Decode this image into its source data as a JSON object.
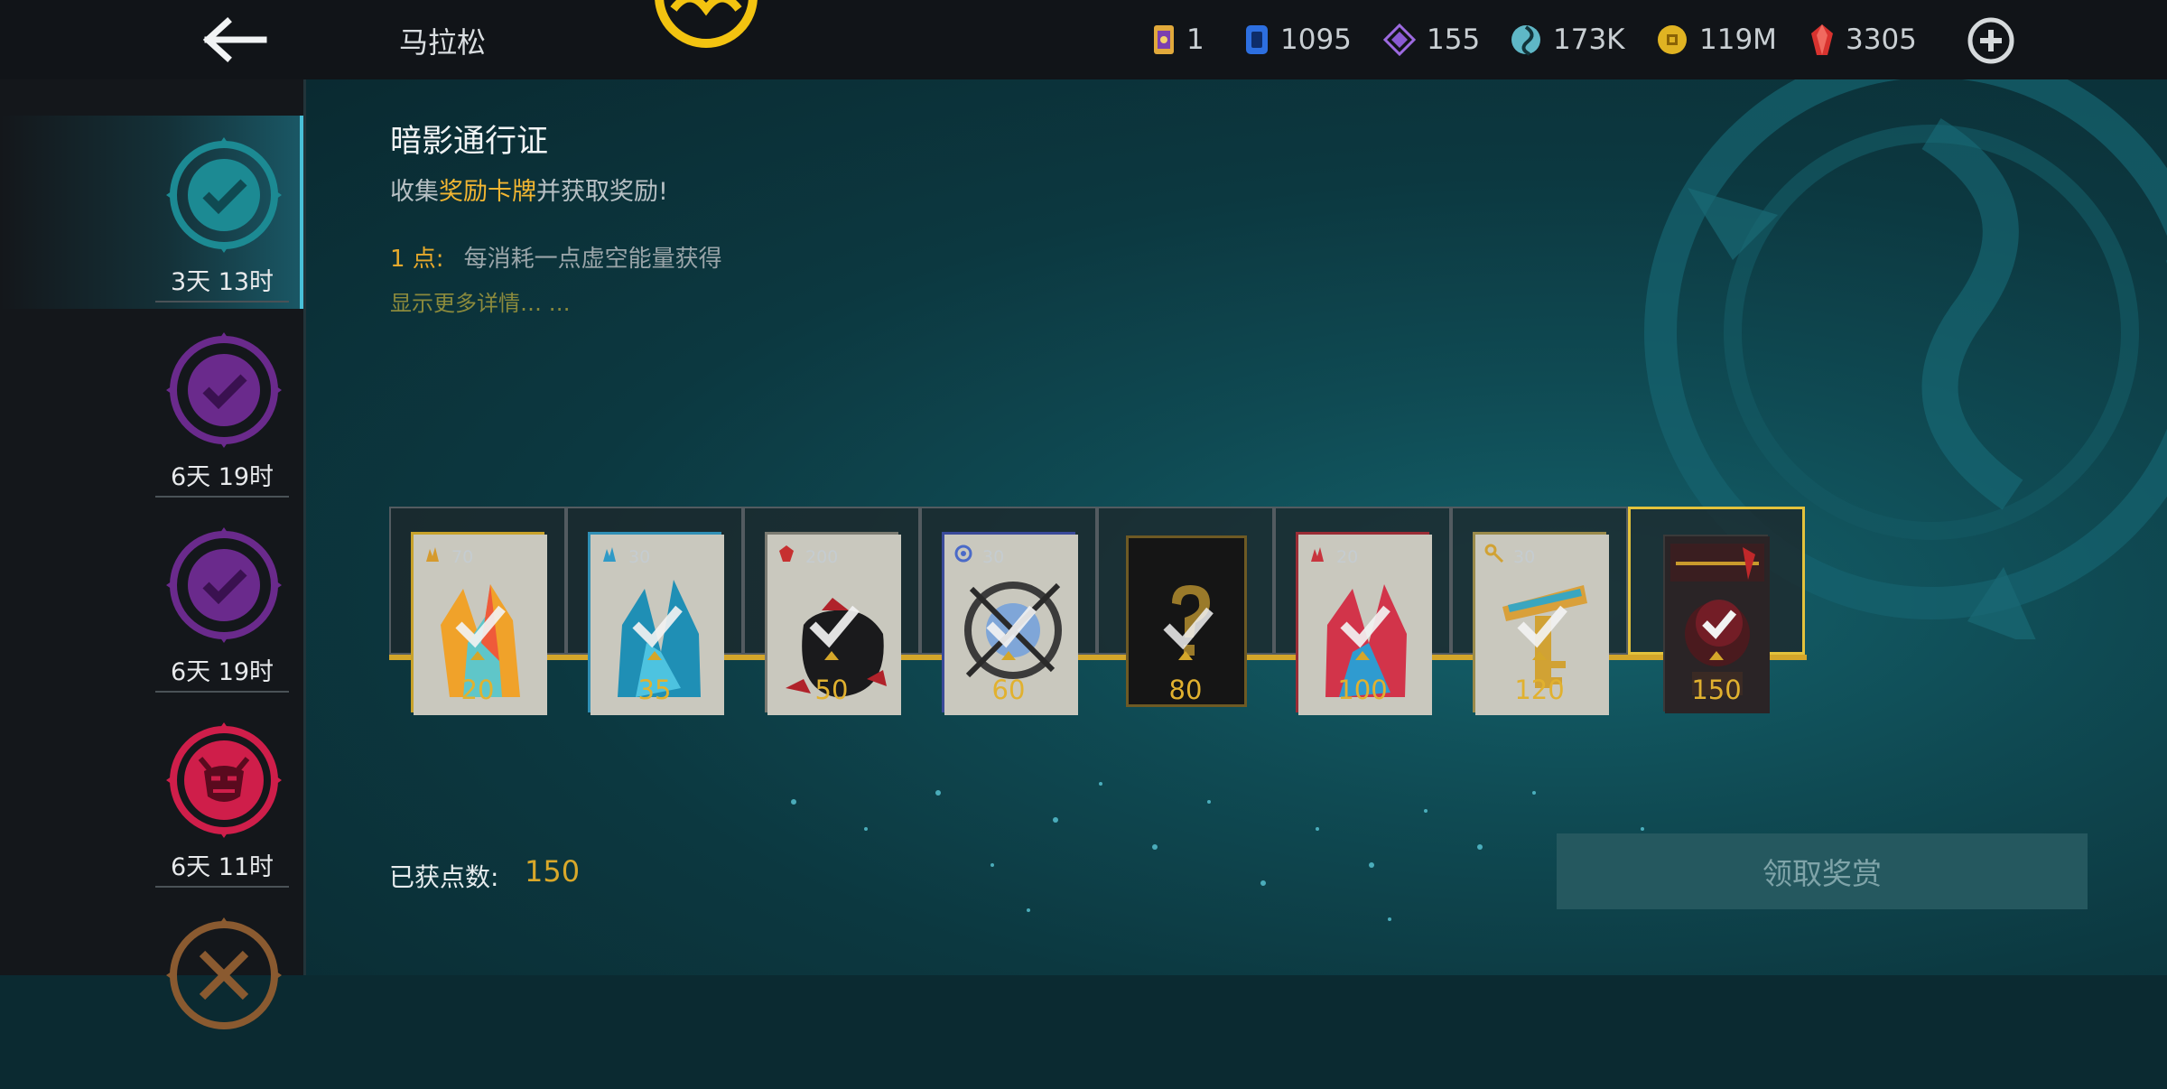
{
  "header": {
    "title": "马拉松",
    "currencies": [
      {
        "icon": "pass-ticket-icon",
        "value": "1"
      },
      {
        "icon": "blue-card-icon",
        "value": "1095"
      },
      {
        "icon": "purple-diamond-icon",
        "value": "155"
      },
      {
        "icon": "teal-orb-icon",
        "value": "173K"
      },
      {
        "icon": "gold-coin-icon",
        "value": "119M"
      },
      {
        "icon": "red-gem-icon",
        "value": "3305"
      }
    ]
  },
  "sidebar": {
    "items": [
      {
        "time": "3天 13时",
        "icon": "teal-check-badge-icon",
        "active": true
      },
      {
        "time": "6天 19时",
        "icon": "purple-check-badge-icon",
        "active": false
      },
      {
        "time": "6天 19时",
        "icon": "purple-check-badge-icon",
        "active": false
      },
      {
        "time": "6天 11时",
        "icon": "red-demon-badge-icon",
        "active": false
      },
      {
        "time": "",
        "icon": "bronze-swords-badge-icon",
        "active": false
      }
    ]
  },
  "pass": {
    "title": "暗影通行证",
    "subtitle_prefix": "收集",
    "subtitle_highlight": "奖励卡牌",
    "subtitle_suffix": "并获取奖励!",
    "rule_points": "1 点:",
    "rule_text": "每消耗一点虚空能量获得",
    "more_link": "显示更多详情… …"
  },
  "rewards": [
    {
      "milestone": "20",
      "count": "70",
      "icon": "gold-crystal-icon",
      "claimed": true
    },
    {
      "milestone": "35",
      "count": "30",
      "icon": "blue-crystal-icon",
      "claimed": true
    },
    {
      "milestone": "50",
      "count": "200",
      "icon": "ruby-bag-icon",
      "claimed": true
    },
    {
      "milestone": "60",
      "count": "30",
      "icon": "orb-compass-icon",
      "claimed": true
    },
    {
      "milestone": "80",
      "count": "",
      "icon": "mystery-card-icon",
      "claimed": true
    },
    {
      "milestone": "100",
      "count": "20",
      "icon": "red-crystal-icon",
      "claimed": true
    },
    {
      "milestone": "120",
      "count": "30",
      "icon": "golden-key-icon",
      "claimed": true
    },
    {
      "milestone": "150",
      "count": "",
      "icon": "game-pack-icon",
      "claimed": true
    }
  ],
  "footer": {
    "points_label": "已获点数:",
    "points_value": "150",
    "claim_label": "领取奖赏"
  },
  "colors": {
    "accent_gold": "#e1b12f",
    "highlight": "#f2b632",
    "active_tab": "#48c0d8"
  }
}
